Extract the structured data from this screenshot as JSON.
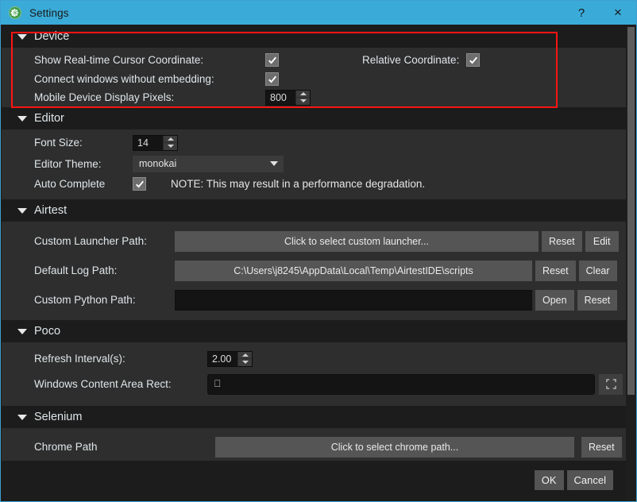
{
  "window": {
    "title": "Settings",
    "icon": "gear-icon",
    "help_label": "?",
    "close_label": "×",
    "titlebar_color": "#3aabd8",
    "accent_color": "#3f9fd0",
    "highlight_color": "#ff1414"
  },
  "sections": {
    "device": {
      "title": "Device",
      "rows": {
        "show_cursor_label": "Show Real-time Cursor Coordinate:",
        "show_cursor_checked": true,
        "relative_coordinate_label": "Relative Coordinate:",
        "relative_coordinate_checked": true,
        "connect_windows_label": "Connect windows without embedding:",
        "connect_windows_checked": true,
        "mobile_pixels_label": "Mobile Device Display Pixels:",
        "mobile_pixels_value": "800"
      }
    },
    "editor": {
      "title": "Editor",
      "rows": {
        "font_size_label": "Font Size:",
        "font_size_value": "14",
        "editor_theme_label": "Editor Theme:",
        "editor_theme_value": "monokai",
        "auto_complete_label": "Auto Complete",
        "auto_complete_checked": true,
        "auto_complete_note": "NOTE: This may result in a performance degradation."
      }
    },
    "airtest": {
      "title": "Airtest",
      "rows": {
        "custom_launcher_label": "Custom Launcher Path:",
        "custom_launcher_value": "Click to select custom launcher...",
        "custom_launcher_reset": "Reset",
        "custom_launcher_edit": "Edit",
        "default_log_label": "Default Log Path:",
        "default_log_value": "C:\\Users\\j8245\\AppData\\Local\\Temp\\AirtestIDE\\scripts",
        "default_log_reset": "Reset",
        "default_log_clear": "Clear",
        "custom_python_label": "Custom Python Path:",
        "custom_python_value": "",
        "custom_python_open": "Open",
        "custom_python_reset": "Reset"
      }
    },
    "poco": {
      "title": "Poco",
      "rows": {
        "refresh_interval_label": "Refresh Interval(s):",
        "refresh_interval_value": "2.00",
        "content_rect_label": "Windows Content Area Rect:",
        "content_rect_value": "⎕",
        "content_rect_button_icon": "select-area-icon"
      }
    },
    "selenium": {
      "title": "Selenium",
      "rows": {
        "chrome_path_label": "Chrome Path",
        "chrome_path_value": "Click to select chrome path...",
        "chrome_path_reset": "Reset"
      }
    }
  },
  "footer": {
    "ok_label": "OK",
    "cancel_label": "Cancel"
  }
}
